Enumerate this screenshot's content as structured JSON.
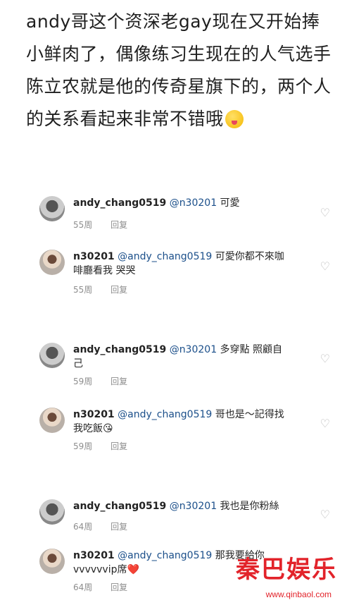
{
  "post": {
    "text": "andy哥这个资深老gay现在又开始捧小鲜肉了，偶像练习生现在的人气选手陈立农就是他的传奇星旗下的，两个人的关系看起来非常不错哦"
  },
  "comments": [
    {
      "user": "andy_chang0519",
      "mention": "@n30201",
      "text": " 可愛",
      "time": "55周",
      "reply": "回复"
    },
    {
      "user": "n30201",
      "mention": "@andy_chang0519",
      "text": " 可愛你都不來咖啡廳看我  哭哭",
      "time": "55周",
      "reply": "回复"
    },
    {
      "user": "andy_chang0519",
      "mention": "@n30201",
      "text": " 多穿點 照顧自己",
      "time": "59周",
      "reply": "回复"
    },
    {
      "user": "n30201",
      "mention": "@andy_chang0519",
      "text": " 哥也是～記得找我吃飯😘",
      "time": "59周",
      "reply": "回复"
    },
    {
      "user": "andy_chang0519",
      "mention": "@n30201",
      "text": " 我也是你粉絲",
      "time": "64周",
      "reply": "回复"
    },
    {
      "user": "n30201",
      "mention": "@andy_chang0519",
      "text": " 那我要給你vvvvvvip席❤️",
      "time": "64周",
      "reply": "回复"
    }
  ],
  "icons": {
    "heart": "heart-outline-icon"
  },
  "watermark": {
    "title": "秦巴娱乐",
    "url": "www.qinbaol.com",
    "color": "#e2232a"
  }
}
